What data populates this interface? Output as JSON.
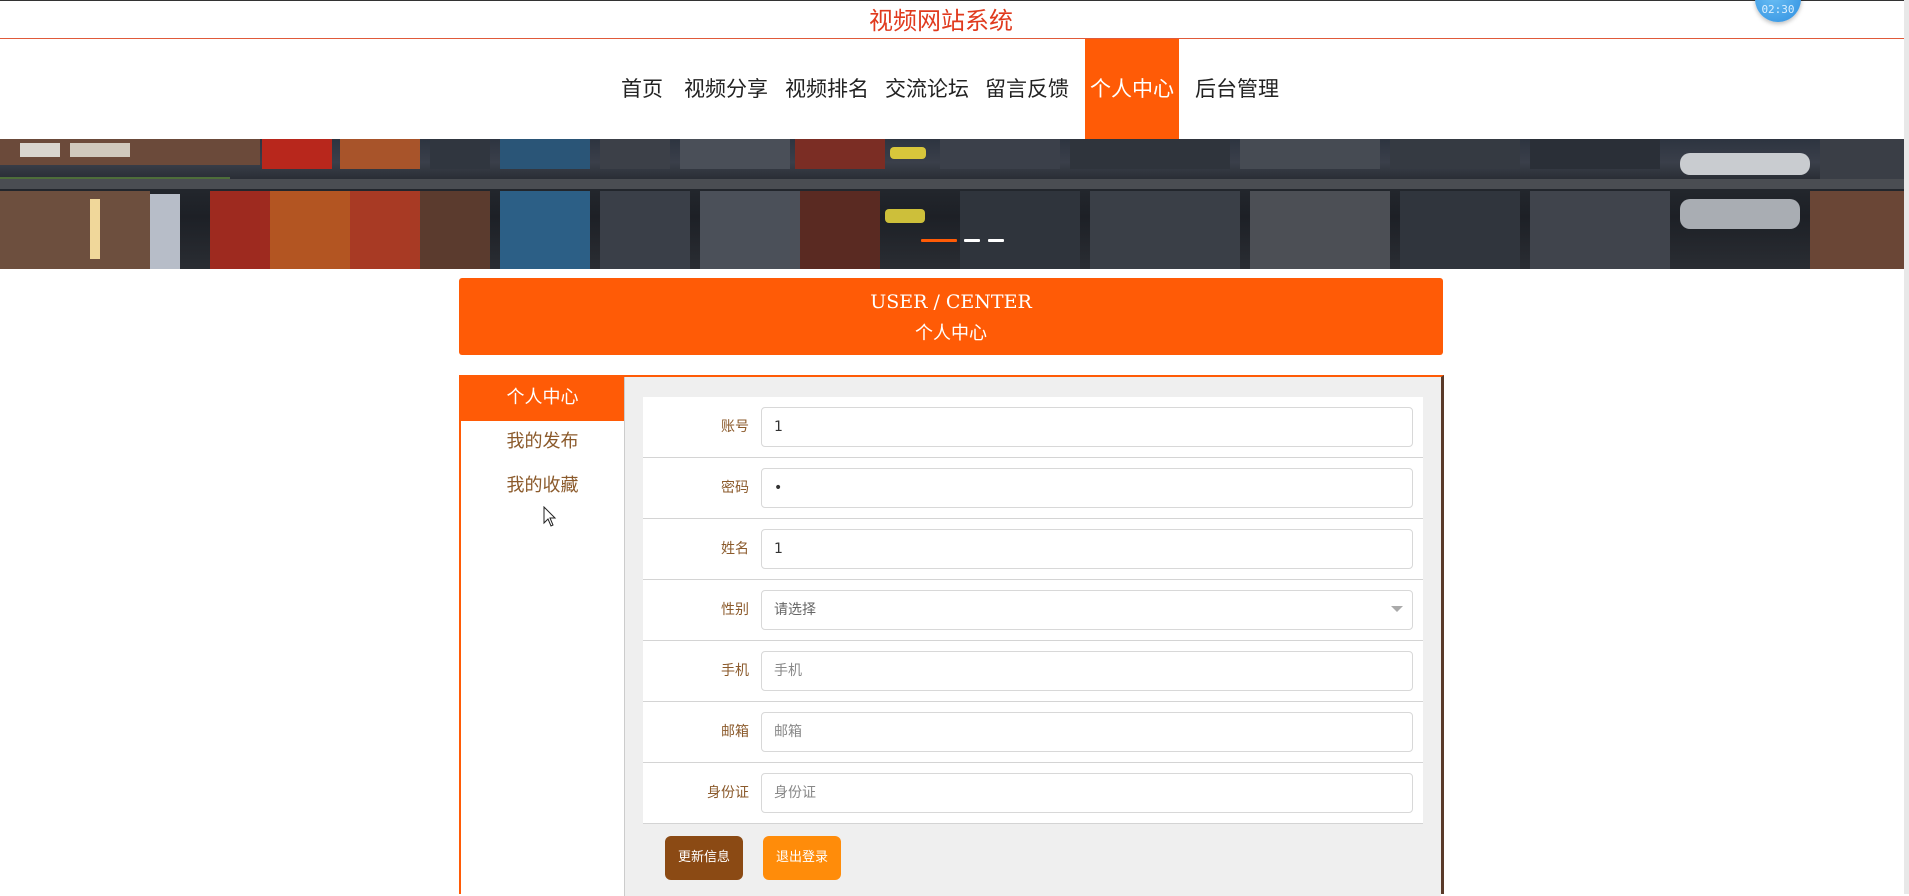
{
  "site": {
    "title": "视频网站系统"
  },
  "nav": {
    "items": [
      {
        "label": "首页",
        "active": false
      },
      {
        "label": "视频分享",
        "active": false
      },
      {
        "label": "视频排名",
        "active": false
      },
      {
        "label": "交流论坛",
        "active": false
      },
      {
        "label": "留言反馈",
        "active": false
      },
      {
        "label": "个人中心",
        "active": true
      },
      {
        "label": "后台管理",
        "active": false
      }
    ]
  },
  "banner": {
    "slider_dots": 3,
    "active_dot": 1
  },
  "user_center": {
    "title_en": "USER / CENTER",
    "title_cn": "个人中心"
  },
  "sidebar": {
    "items": [
      {
        "label": "个人中心",
        "active": true
      },
      {
        "label": "我的发布",
        "active": false
      },
      {
        "label": "我的收藏",
        "active": false
      }
    ]
  },
  "form": {
    "account": {
      "label": "账号",
      "value": "1",
      "placeholder": ""
    },
    "password": {
      "label": "密码",
      "value": "•",
      "placeholder": ""
    },
    "name": {
      "label": "姓名",
      "value": "1",
      "placeholder": ""
    },
    "gender": {
      "label": "性别",
      "selected": "请选择"
    },
    "phone": {
      "label": "手机",
      "value": "",
      "placeholder": "手机"
    },
    "email": {
      "label": "邮箱",
      "value": "",
      "placeholder": "邮箱"
    },
    "id_card": {
      "label": "身份证",
      "value": "",
      "placeholder": "身份证"
    }
  },
  "buttons": {
    "update_label": "更新信息",
    "logout_label": "退出登录"
  },
  "colors": {
    "accent": "#ff5b06",
    "title": "#e03a1e",
    "label": "#8b5a2b",
    "update_button": "#8b4a14",
    "logout_button": "#ff8c0a"
  },
  "icons": {
    "caret": "chevron-down-icon",
    "cursor": "mouse-pointer-icon",
    "clock": "clock-badge-icon"
  }
}
